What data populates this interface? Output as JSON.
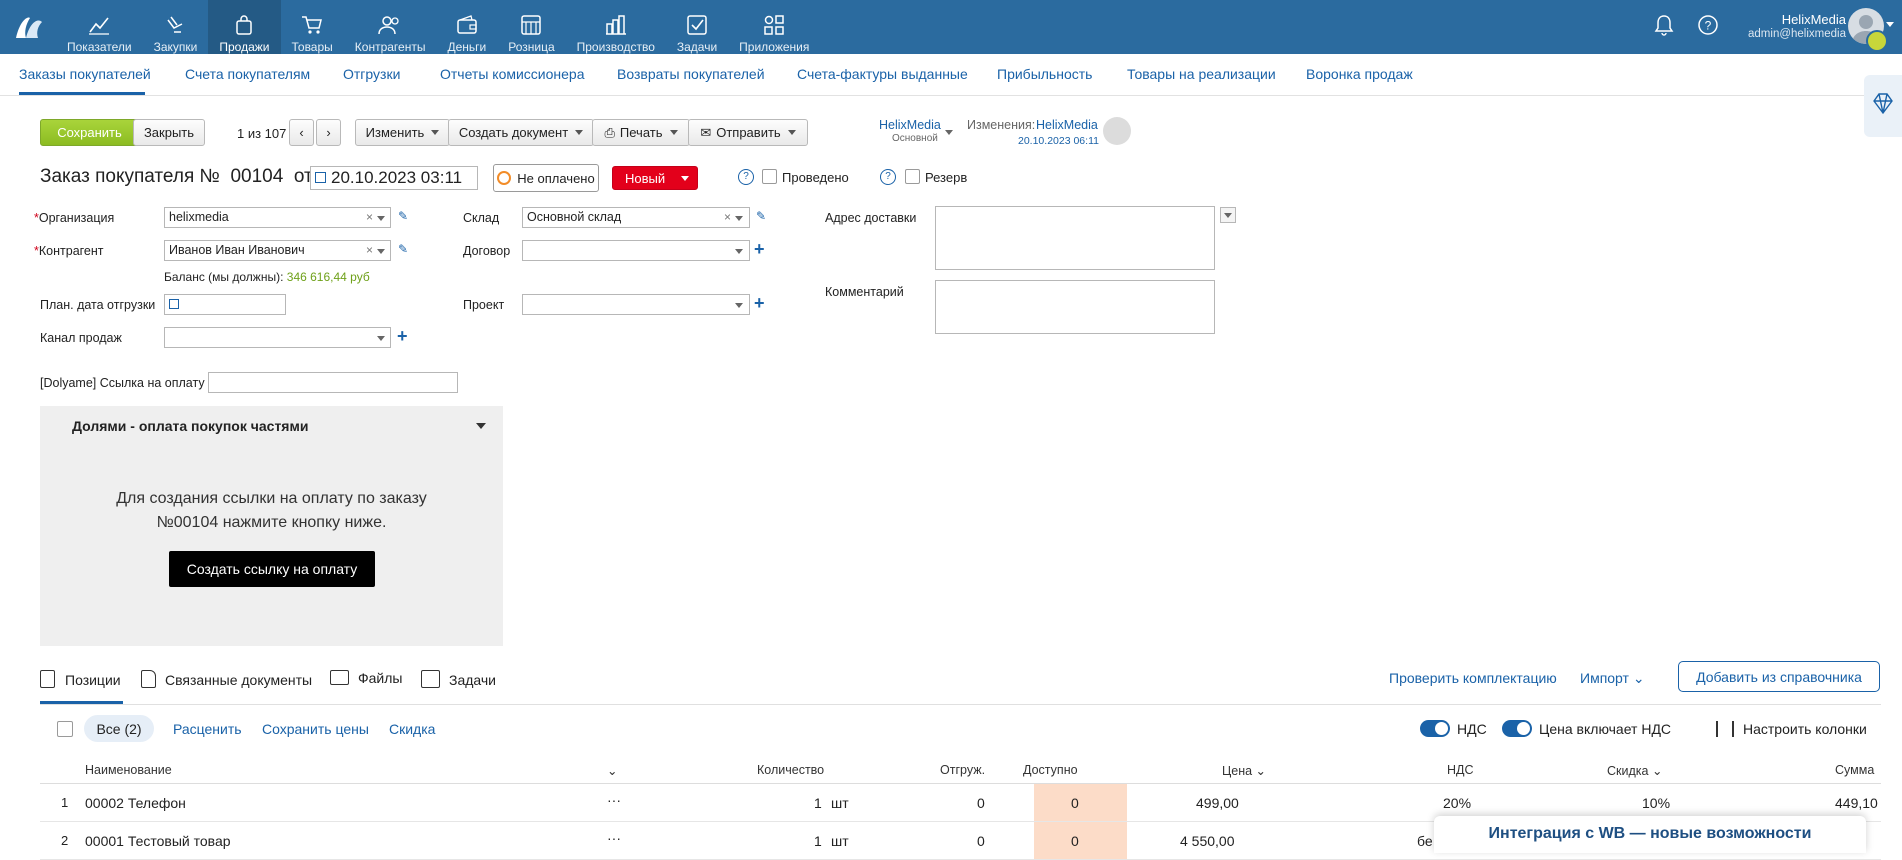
{
  "nav": {
    "items": [
      {
        "label": "Показатели",
        "icon": "chart-icon"
      },
      {
        "label": "Закупки",
        "icon": "hand-icon"
      },
      {
        "label": "Продажи",
        "icon": "bag-icon"
      },
      {
        "label": "Товары",
        "icon": "cart-icon"
      },
      {
        "label": "Контрагенты",
        "icon": "people-icon"
      },
      {
        "label": "Деньги",
        "icon": "wallet-icon"
      },
      {
        "label": "Розница",
        "icon": "store-icon"
      },
      {
        "label": "Производство",
        "icon": "factory-icon"
      },
      {
        "label": "Задачи",
        "icon": "tasks-icon"
      },
      {
        "label": "Приложения",
        "icon": "apps-icon"
      }
    ],
    "user_name": "HelixMedia",
    "user_email": "admin@helixmedia"
  },
  "subtabs": [
    "Заказы покупателей",
    "Счета покупателям",
    "Отгрузки",
    "Отчеты комиссионера",
    "Возвраты покупателей",
    "Счета-фактуры выданные",
    "Прибыльность",
    "Товары на реализации",
    "Воронка продаж"
  ],
  "toolbar": {
    "save": "Сохранить",
    "close": "Закрыть",
    "pager": "1 из 107",
    "edit": "Изменить",
    "create_doc": "Создать документ",
    "print": "Печать",
    "send": "Отправить",
    "owner_name": "HelixMedia",
    "owner_sub": "Основной",
    "changes_label": "Изменения:",
    "changes_user": "HelixMedia",
    "changes_date": "20.10.2023 06:11"
  },
  "order": {
    "title": "Заказ покупателя №",
    "number": "00104",
    "from": "от",
    "date": "20.10.2023 03:11",
    "payment_status": "Не оплачено",
    "status": "Новый",
    "posted_label": "Проведено",
    "reserve_label": "Резерв"
  },
  "form": {
    "org_label": "Организация",
    "org_value": "helixmedia",
    "contractor_label": "Контрагент",
    "contractor_value": "Иванов Иван Иванович",
    "balance_label": "Баланс (мы должны):",
    "balance_value": "346 616,44 руб",
    "plan_date_label": "План. дата отгрузки",
    "channel_label": "Канал продаж",
    "warehouse_label": "Склад",
    "warehouse_value": "Основной склад",
    "contract_label": "Договор",
    "project_label": "Проект",
    "address_label": "Адрес доставки",
    "comment_label": "Комментарий",
    "dolyame_label": "[Dolyame] Ссылка на оплату"
  },
  "dolyame": {
    "title": "Долями - оплата покупок частями",
    "text_line1": "Для создания ссылки на оплату по заказу",
    "text_line2": "№00104 нажмите кнопку ниже.",
    "button": "Создать ссылку на оплату"
  },
  "bottom_tabs": {
    "positions": "Позиции",
    "related": "Связанные документы",
    "files": "Файлы",
    "tasks": "Задачи",
    "check": "Проверить комплектацию",
    "import": "Импорт",
    "add_from_catalog": "Добавить из справочника"
  },
  "list_toolbar": {
    "all": "Все (2)",
    "reprice": "Расценить",
    "save_prices": "Сохранить цены",
    "discount": "Скидка",
    "vat": "НДС",
    "price_incl_vat": "Цена включает НДС",
    "columns": "Настроить колонки"
  },
  "table": {
    "headers": {
      "name": "Наименование",
      "qty": "Количество",
      "shipped": "Отгруж.",
      "available": "Доступно",
      "price": "Цена",
      "vat": "НДС",
      "discount": "Скидка",
      "sum": "Сумма"
    },
    "rows": [
      {
        "n": "1",
        "name": "00002 Телефон",
        "more": "···",
        "qty": "1",
        "unit": "шт",
        "shipped": "0",
        "available": "0",
        "price": "499,00",
        "vat": "20%",
        "discount": "10%",
        "sum": "449,10"
      },
      {
        "n": "2",
        "name": "00001 Тестовый товар",
        "more": "···",
        "qty": "1",
        "unit": "шт",
        "shipped": "0",
        "available": "0",
        "price": "4 550,00",
        "vat": "бе",
        "discount": "",
        "sum": ""
      }
    ]
  },
  "promo": "Интеграция с WB — новые возможности",
  "colors": {
    "nav_bg": "#2b6b9f",
    "link": "#1a62a8",
    "status_red": "#e3001b",
    "save_green": "#8cbc22",
    "available_bg": "#fcdcc8"
  }
}
